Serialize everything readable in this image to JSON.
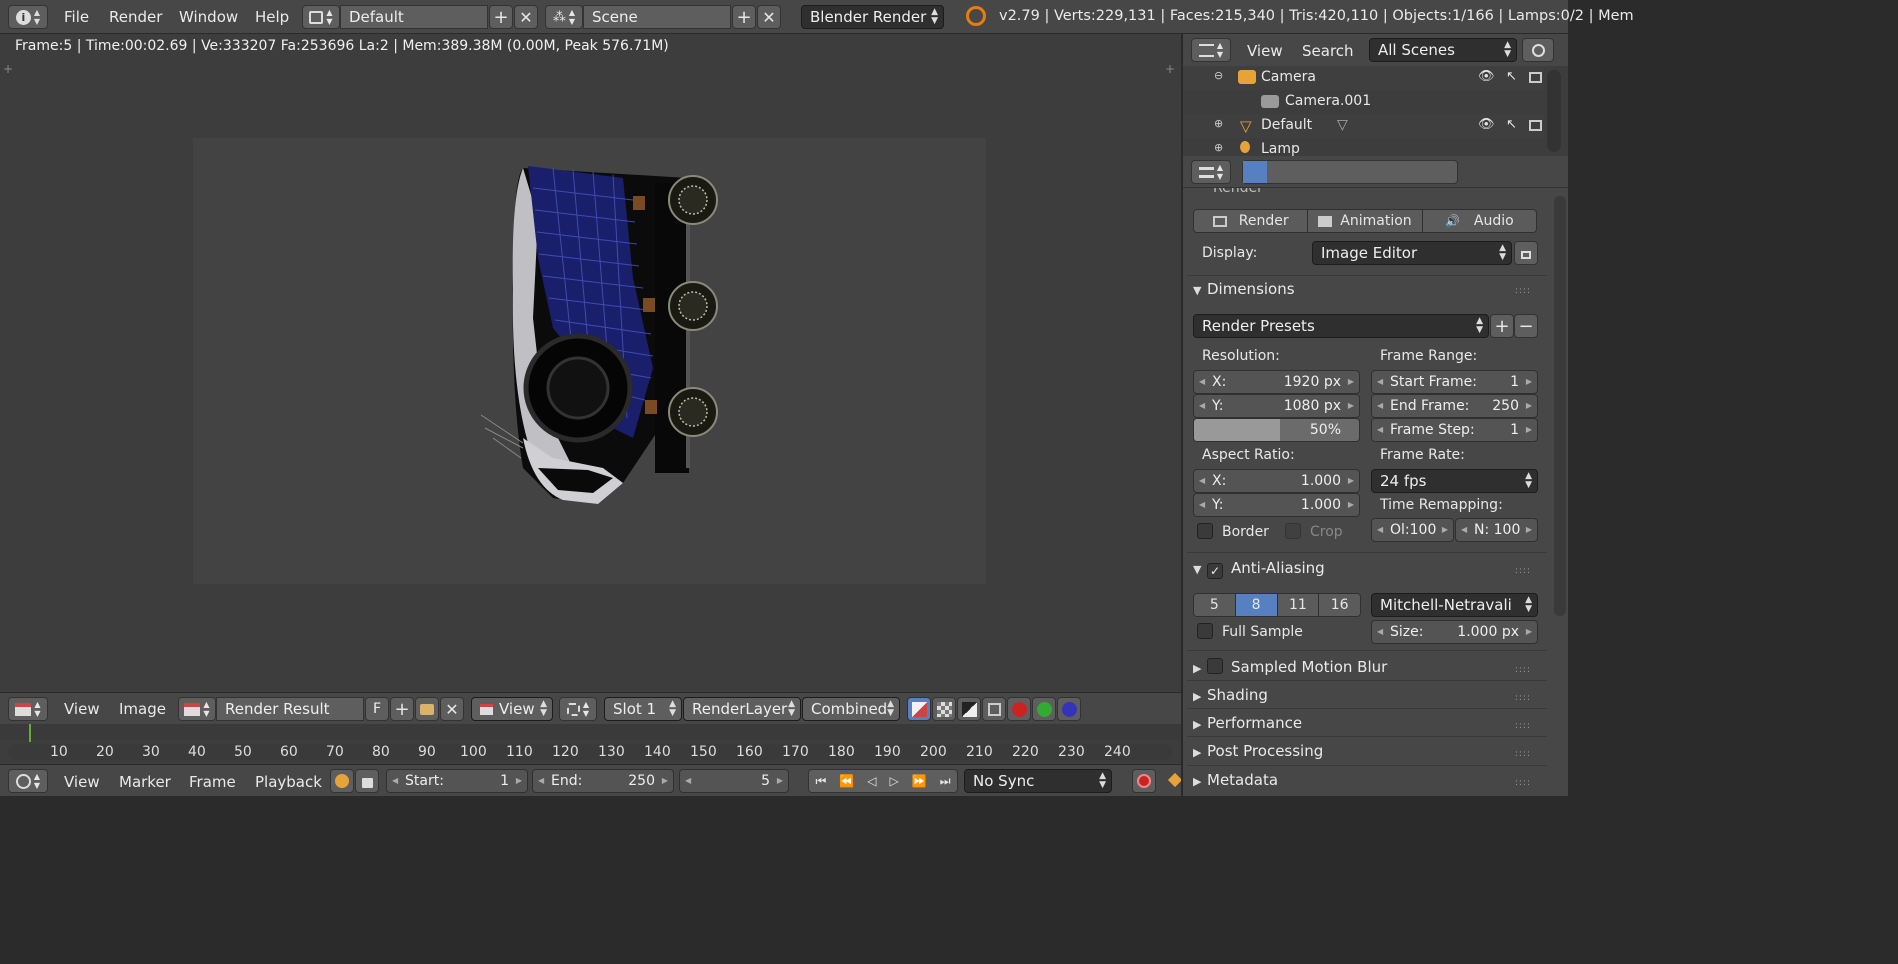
{
  "topbar": {
    "menus": [
      "File",
      "Render",
      "Window",
      "Help"
    ],
    "layout_value": "Default",
    "scene_value": "Scene",
    "engine_value": "Blender Render",
    "stats": "v2.79 | Verts:229,131 | Faces:215,340 | Tris:420,110 | Objects:1/166 | Lamps:0/2 | Mem"
  },
  "viewport": {
    "info": "Frame:5 | Time:00:02.69 | Ve:333207 Fa:253696 La:2 | Mem:389.38M (0.00M, Peak 576.71M)"
  },
  "image_editor": {
    "menus": [
      "View",
      "Image"
    ],
    "image_name": "Render Result",
    "fake_user": "F",
    "view_value": "View",
    "slot_value": "Slot 1",
    "layer_value": "RenderLayer",
    "pass_value": "Combined"
  },
  "timeline": {
    "ticks": [
      "10",
      "20",
      "30",
      "40",
      "50",
      "60",
      "70",
      "80",
      "90",
      "100",
      "110",
      "120",
      "130",
      "140",
      "150",
      "160",
      "170",
      "180",
      "190",
      "200",
      "210",
      "220",
      "230",
      "240"
    ],
    "menus": [
      "View",
      "Marker",
      "Frame",
      "Playback"
    ],
    "start_label": "Start:",
    "start_value": "1",
    "end_label": "End:",
    "end_value": "250",
    "current_frame": "5",
    "sync_value": "No Sync"
  },
  "outliner": {
    "menus": [
      "View",
      "Search"
    ],
    "filter_value": "All Scenes",
    "items": [
      {
        "label": "Camera"
      },
      {
        "label": "Camera.001"
      },
      {
        "label": "Default"
      },
      {
        "label": "Lamp"
      }
    ]
  },
  "props": {
    "render_tab_partial": "Render",
    "render_btn": "Render",
    "animation_btn": "Animation",
    "audio_btn": "Audio",
    "display_label": "Display:",
    "display_value": "Image Editor",
    "dimensions_title": "Dimensions",
    "presets_value": "Render Presets",
    "resolution_label": "Resolution:",
    "res_x_label": "X:",
    "res_x_value": "1920 px",
    "res_y_label": "Y:",
    "res_y_value": "1080 px",
    "res_pct": "50%",
    "res_pct_fraction": 0.5,
    "frame_range_label": "Frame Range:",
    "start_frame_label": "Start Frame:",
    "start_frame_value": "1",
    "end_frame_label": "End Frame:",
    "end_frame_value": "250",
    "frame_step_label": "Frame Step:",
    "frame_step_value": "1",
    "aspect_label": "Aspect Ratio:",
    "aspect_x_label": "X:",
    "aspect_x_value": "1.000",
    "aspect_y_label": "Y:",
    "aspect_y_value": "1.000",
    "frame_rate_label": "Frame Rate:",
    "frame_rate_value": "24 fps",
    "time_remap_label": "Time Remapping:",
    "remap_old": "Ol:100",
    "remap_new": "N: 100",
    "border_label": "Border",
    "crop_label": "Crop",
    "aa_title": "Anti-Aliasing",
    "aa_samples": [
      "5",
      "8",
      "11",
      "16"
    ],
    "aa_selected": "8",
    "filter_value": "Mitchell-Netravali",
    "full_sample_label": "Full Sample",
    "size_label": "Size:",
    "size_value": "1.000 px",
    "collapsed_panels": [
      "Sampled Motion Blur",
      "Shading",
      "Performance",
      "Post Processing",
      "Metadata"
    ]
  },
  "colors": {
    "accent_blue": "#5680c2",
    "bg_dark": "#3d3d3d",
    "header": "#474747"
  }
}
